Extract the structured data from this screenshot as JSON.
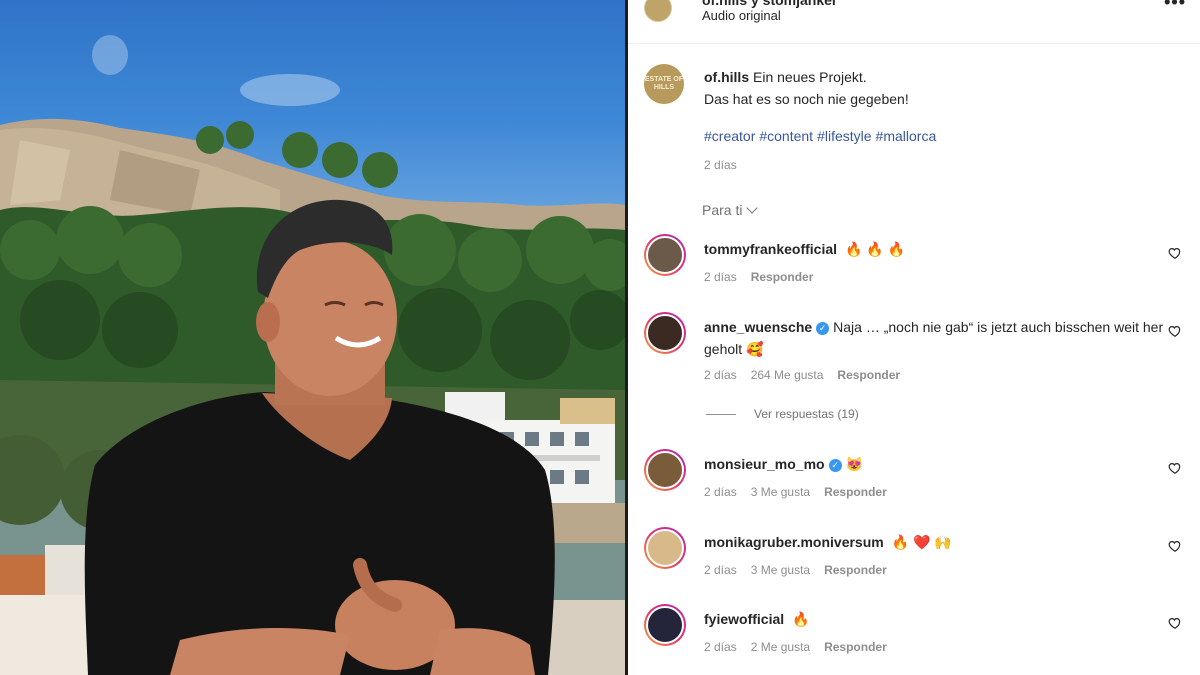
{
  "post": {
    "header_title": "of.hills y stomjanker",
    "audio": "Audio original",
    "more": "•••",
    "avatar_text": "ESTATE OF HILLS"
  },
  "caption": {
    "user": "of.hills",
    "line1": "Ein neues Projekt.",
    "line2": "Das hat es so noch nie gegeben!",
    "hashtags": [
      "#creator",
      "#content",
      "#lifestyle",
      "#mallorca"
    ],
    "time": "2 días"
  },
  "sort": {
    "label": "Para ti"
  },
  "comments": [
    {
      "user": "tommyfrankeofficial",
      "verified": false,
      "text": "",
      "emoji": "🔥 🔥 🔥",
      "time": "2 días",
      "likes": "",
      "reply": "Responder",
      "avatar_color": "#6b5a4a"
    },
    {
      "user": "anne_wuensche",
      "verified": true,
      "text": "Naja … „noch nie gab“ is jetzt auch bisschen weit her geholt",
      "emoji": "🥰",
      "time": "2 días",
      "likes": "264 Me gusta",
      "reply": "Responder",
      "avatar_color": "#3a2a22"
    },
    {
      "user": "monsieur_mo_mo",
      "verified": true,
      "text": "",
      "emoji": "😻",
      "time": "2 días",
      "likes": "3 Me gusta",
      "reply": "Responder",
      "avatar_color": "#7a5c3a"
    },
    {
      "user": "monikagruber.moniversum",
      "verified": false,
      "text": "",
      "emoji": "🔥 ❤️ 🙌",
      "time": "2 días",
      "likes": "3 Me gusta",
      "reply": "Responder",
      "avatar_color": "#d8b98a"
    },
    {
      "user": "fyiewofficial",
      "verified": false,
      "text": "",
      "emoji": "🔥",
      "time": "2 días",
      "likes": "2 Me gusta",
      "reply": "Responder",
      "avatar_color": "#24243a"
    }
  ],
  "view_replies": "Ver respuestas (19)",
  "colors": {
    "hashtag": "#385898",
    "muted": "#8e8e8e",
    "verified": "#3897f0"
  }
}
